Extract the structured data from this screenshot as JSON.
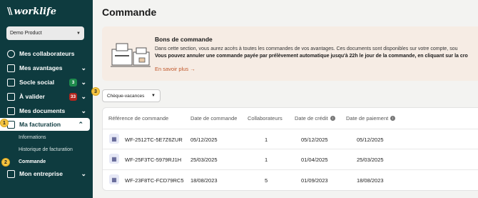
{
  "brand": {
    "mark": "\\\\",
    "name": "worklife"
  },
  "sidebar": {
    "product_select": "Demo Product",
    "items": [
      {
        "label": "Mes collaborateurs",
        "icon": "people-icon"
      },
      {
        "label": "Mes avantages",
        "icon": "grid-icon"
      },
      {
        "label": "Socle social",
        "icon": "scale-icon",
        "badge": "3",
        "badge_color": "#1e8a4c"
      },
      {
        "label": "À valider",
        "icon": "inbox-icon",
        "badge": "33",
        "badge_color": "#b3261e"
      },
      {
        "label": "Mes documents",
        "icon": "folder-icon"
      },
      {
        "label": "Ma facturation",
        "icon": "billing-icon",
        "active": true
      },
      {
        "label": "Mon entreprise",
        "icon": "building-icon"
      }
    ],
    "sub_items": [
      "Informations",
      "Historique de facturation",
      "Commande"
    ]
  },
  "markers": [
    "1",
    "2",
    "3"
  ],
  "main": {
    "title": "Commande",
    "info": {
      "title": "Bons de commande",
      "line1": "Dans cette section, vous aurez accès à toutes les commandes de vos avantages. Ces documents sont disponibles sur votre compte, sou",
      "line2": "Vous pouvez annuler une commande payée par prélèvement automatique jusqu'à 22h le jour de la commande, en cliquant sur la cro",
      "link": "En savoir plus →"
    },
    "filter": {
      "value": "Chèque-vacances"
    },
    "table": {
      "headers": [
        "Référence de commande",
        "Date de commande",
        "Collaborateurs",
        "Date de crédit",
        "Date de paiement"
      ],
      "rows": [
        [
          "WF-2512TC-5E7Z6ZUR",
          "05/12/2025",
          "1",
          "05/12/2025",
          "05/12/2025"
        ],
        [
          "WF-25F3TC-5979RJ1H",
          "25/03/2025",
          "1",
          "01/04/2025",
          "25/03/2025"
        ],
        [
          "WF-23F8TC-FCD79RC5",
          "18/08/2023",
          "5",
          "01/09/2023",
          "18/08/2023"
        ]
      ]
    }
  }
}
